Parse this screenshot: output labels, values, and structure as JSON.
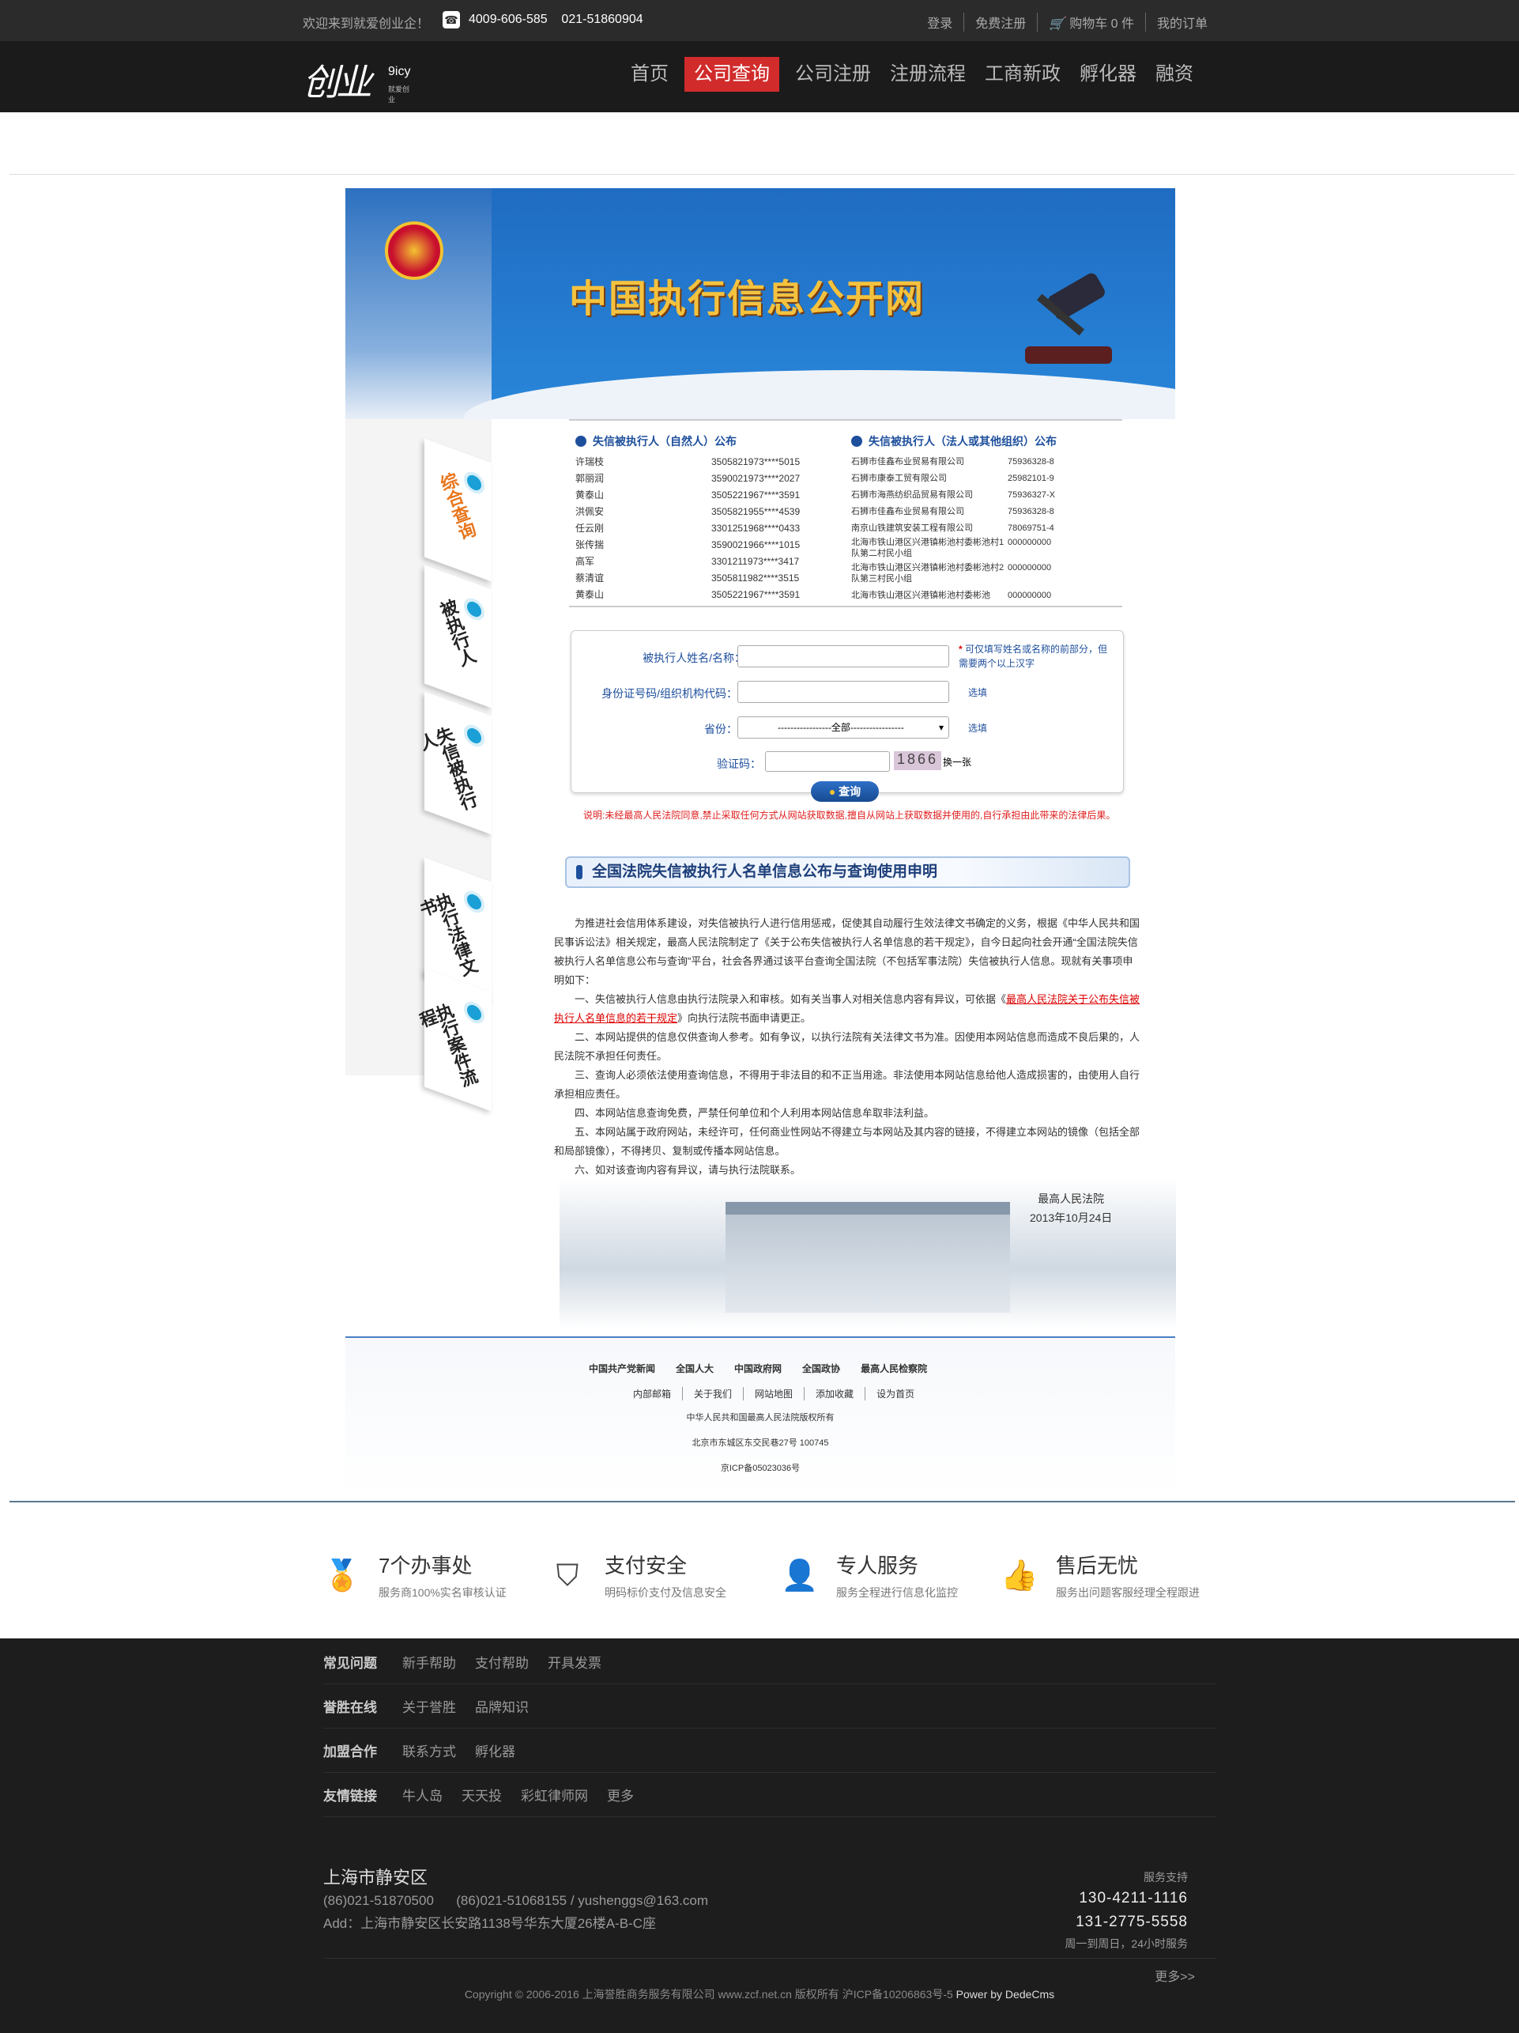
{
  "topbar": {
    "welcome": "欢迎来到就爱创业企！",
    "phones": "4009-606-585    021-51860904",
    "login": "登录",
    "register": "免费注册",
    "cart": "购物车 0 件",
    "orders": "我的订单"
  },
  "logo": {
    "mark": "创业",
    "en": "9icy",
    "cn": "就爱创业"
  },
  "nav": [
    "首页",
    "公司查询",
    "公司注册",
    "注册流程",
    "工商新政",
    "孵化器",
    "融资"
  ],
  "nav_active": 1,
  "banner": {
    "title": "中国执行信息公开网"
  },
  "sidetabs": [
    "综合查询",
    "被执行人",
    "失信被执行人",
    "执行法律文书",
    "执行案件流程"
  ],
  "list_person": {
    "heading": "失信被执行人（自然人）公布",
    "rows": [
      [
        "许瑞枝",
        "3505821973****5015"
      ],
      [
        "郭丽润",
        "3590021973****2027"
      ],
      [
        "黄泰山",
        "3505221967****3591"
      ],
      [
        "洪佩安",
        "3505821955****4539"
      ],
      [
        "任云刚",
        "3301251968****0433"
      ],
      [
        "张传揣",
        "3590021966****1015"
      ],
      [
        "高军",
        "3301211973****3417"
      ],
      [
        "蔡清谊",
        "3505811982****3515"
      ],
      [
        "黄泰山",
        "3505221967****3591"
      ]
    ]
  },
  "list_org": {
    "heading": "失信被执行人（法人或其他组织）公布",
    "rows": [
      [
        "石狮市佳鑫布业贸易有限公司",
        "75936328-8"
      ],
      [
        "石狮市康泰工贸有限公司",
        "25982101-9"
      ],
      [
        "石狮市海燕纺织品贸易有限公司",
        "75936327-X"
      ],
      [
        "石狮市佳鑫布业贸易有限公司",
        "75936328-8"
      ],
      [
        "南京山铁建筑安装工程有限公司",
        "78069751-4"
      ],
      [
        "北海市铁山港区兴港镇彬池村委彬池村1队第二村民小组",
        "000000000"
      ],
      [
        "北海市铁山港区兴港镇彬池村委彬池村2队第三村民小组",
        "000000000"
      ],
      [
        "北海市铁山港区兴港镇彬池村委彬池",
        "000000000"
      ]
    ]
  },
  "form": {
    "name_label": "被执行人姓名/名称：",
    "name_hint": "可仅填写姓名或名称的前部分，但需要两个以上汉字",
    "id_label": "身份证号码/组织机构代码：",
    "id_hint": "选填",
    "province_label": "省份：",
    "province_value": "-----------------全部-----------------",
    "province_hint": "选填",
    "captcha_label": "验证码：",
    "captcha_code": "1866",
    "captcha_refresh": "换一张",
    "submit": "查询"
  },
  "note": "说明:未经最高人民法院同意,禁止采取任何方式从网站获取数据,擅自从网站上获取数据并使用的,自行承担由此带来的法律后果。",
  "section_title": "全国法院失信被执行人名单信息公布与查询使用申明",
  "statement": {
    "p1": "为推进社会信用体系建设，对失信被执行人进行信用惩戒，促使其自动履行生效法律文书确定的义务，根据《中华人民共和国民事诉讼法》相关规定，最高人民法院制定了《关于公布失信被执行人名单信息的若干规定》，自今日起向社会开通“全国法院失信被执行人名单信息公布与查询”平台，社会各界通过该平台查询全国法院（不包括军事法院）失信被执行人信息。现就有关事项申明如下：",
    "p2a": "一、失信被执行人信息由执行法院录入和审核。如有关当事人对相关信息内容有异议，可依据《",
    "p2link": "最高人民法院关于公布失信被执行人名单信息的若干规定",
    "p2b": "》向执行法院书面申请更正。",
    "p3": "二、本网站提供的信息仅供查询人参考。如有争议，以执行法院有关法律文书为准。因使用本网站信息而造成不良后果的，人民法院不承担任何责任。",
    "p4": "三、查询人必须依法使用查询信息，不得用于非法目的和不正当用途。非法使用本网站信息给他人造成损害的，由使用人自行承担相应责任。",
    "p5": "四、本网站信息查询免费，严禁任何单位和个人利用本网站信息牟取非法利益。",
    "p6": "五、本网站属于政府网站，未经许可，任何商业性网站不得建立与本网站及其内容的链接，不得建立本网站的镜像（包括全部和局部镜像），不得拷贝、复制或传播本网站信息。",
    "p7": "六、如对该查询内容有异议，请与执行法院联系。",
    "sign1": "最高人民法院",
    "sign2": "2013年10月24日"
  },
  "court_footer": {
    "links1": [
      "中国共产党新闻",
      "全国人大",
      "中国政府网",
      "全国政协",
      "最高人民检察院"
    ],
    "links2": [
      "内部邮箱",
      "关于我们",
      "网站地图",
      "添加收藏",
      "设为首页"
    ],
    "copy1": "中华人民共和国最高人民法院版权所有",
    "copy2": "北京市东城区东交民巷27号  100745",
    "copy3": "京ICP备05023036号"
  },
  "features": [
    {
      "icon": "medal-icon",
      "title": "7个办事处",
      "sub": "服务商100%实名审核认证"
    },
    {
      "icon": "shield-check-icon",
      "title": "支付安全",
      "sub": "明码标价支付及信息安全"
    },
    {
      "icon": "user-icon",
      "title": "专人服务",
      "sub": "服务全程进行信息化监控"
    },
    {
      "icon": "thumbs-up-icon",
      "title": "售后无忧",
      "sub": "服务出问题客服经理全程跟进"
    }
  ],
  "footer": {
    "rows": [
      {
        "head": "常见问题",
        "items": [
          "新手帮助",
          "支付帮助",
          "开具发票"
        ]
      },
      {
        "head": "誉胜在线",
        "items": [
          "关于誉胜",
          "品牌知识"
        ]
      },
      {
        "head": "加盟合作",
        "items": [
          "联系方式",
          "孵化器"
        ]
      },
      {
        "head": "友情链接",
        "items": [
          "牛人岛",
          "天天投",
          "彩虹律师网",
          "更多"
        ]
      }
    ],
    "city": "上海市静安区",
    "tel": "(86)021-51870500      (86)021-51068155 / yushenggs@163.com",
    "addr": "Add：上海市静安区长安路1138号华东大厦26楼A-B-C座",
    "support_label": "服务支持",
    "phone1": "130-4211-1116",
    "phone2": "131-2775-5558",
    "hours": "周一到周日，24小时服务",
    "more": "更多>>",
    "copy": "Copyright © 2006-2016 上海誉胜商务服务有限公司 www.zcf.net.cn 版权所有  沪ICP备10206863号-5 ",
    "powered": "Power by DedeCms"
  }
}
